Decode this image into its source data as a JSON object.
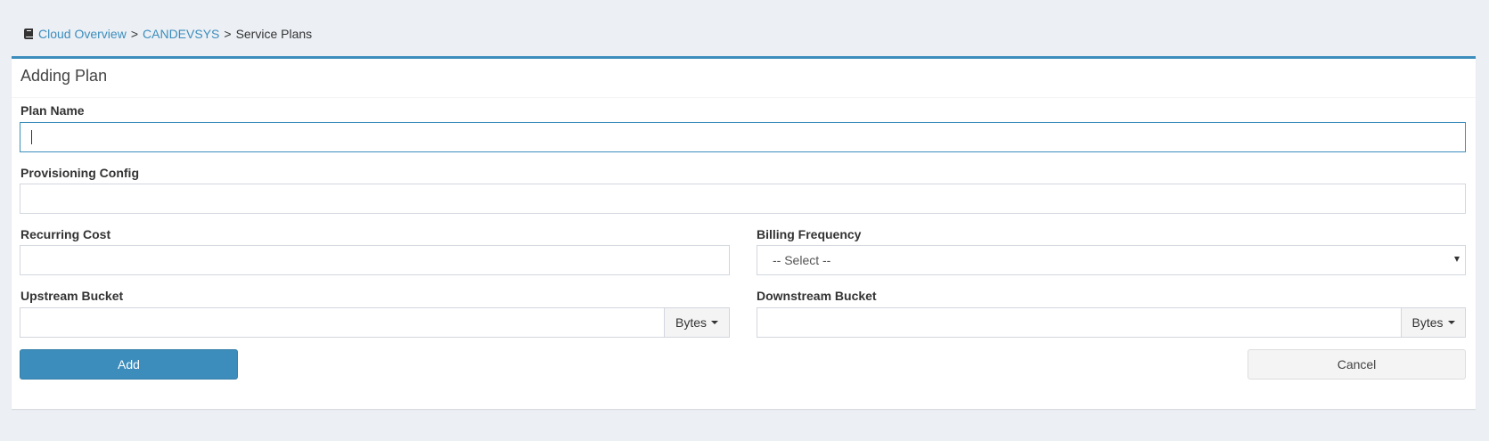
{
  "breadcrumb": {
    "items": [
      "Cloud Overview",
      "CANDEVSYS"
    ],
    "current": "Service Plans",
    "separator": ">"
  },
  "box": {
    "title": "Adding Plan"
  },
  "form": {
    "plan_name": {
      "label": "Plan Name",
      "value": ""
    },
    "provisioning_config": {
      "label": "Provisioning Config",
      "value": ""
    },
    "recurring_cost": {
      "label": "Recurring Cost",
      "value": ""
    },
    "billing_frequency": {
      "label": "Billing Frequency",
      "selected": "-- Select --"
    },
    "upstream_bucket": {
      "label": "Upstream Bucket",
      "value": "",
      "unit": "Bytes"
    },
    "downstream_bucket": {
      "label": "Downstream Bucket",
      "value": "",
      "unit": "Bytes"
    }
  },
  "actions": {
    "add_label": "Add",
    "cancel_label": "Cancel"
  },
  "colors": {
    "accent": "#3c8dbc",
    "background": "#ecf0f5"
  }
}
